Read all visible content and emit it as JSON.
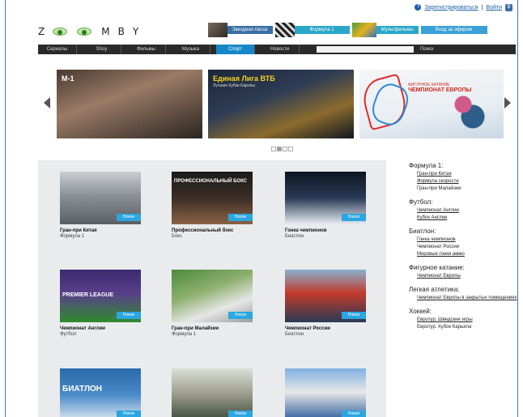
{
  "header": {
    "register_link": "Зарегистрироваться",
    "separator": "|",
    "login_link": "Войти",
    "logo_letters": [
      "Z",
      "M",
      "B",
      "Y"
    ],
    "promos": [
      "Звездная пасха",
      "Формула 1",
      "Мультфильмы",
      "Вход за эфиром"
    ]
  },
  "nav": {
    "items": [
      "Сериалы",
      "Shoy",
      "Фильмы",
      "Музыка",
      "Спорт",
      "Новости"
    ],
    "active_index": 4,
    "search_placeholder": "",
    "search_button": "Поиск"
  },
  "carousel": {
    "slides": [
      {
        "title": "M-1",
        "subtitle": ""
      },
      {
        "title": "Единая Лига ВТБ",
        "subtitle": "Лучшие Кубки Европы"
      },
      {
        "title": "ЧЕМПИОНАТ ЕВРОПЫ",
        "subtitle": "ФИГУРНОЕ КАТАНИЕ"
      }
    ],
    "pages": 4,
    "active_page": 1
  },
  "cards": [
    {
      "title": "Гран-при Китая",
      "subtitle": "Формула 1",
      "badge": "Новое",
      "image_text": ""
    },
    {
      "title": "Профессиональный бокс",
      "subtitle": "Бокс",
      "badge": "Новое",
      "image_text": "ПРОФЕССИОНАЛЬНЫЙ БОКС"
    },
    {
      "title": "Гонка чемпионов",
      "subtitle": "Биатлон",
      "badge": "Новое",
      "image_text": ""
    },
    {
      "title": "Чемпионат Англии",
      "subtitle": "Футбол",
      "badge": "Новое",
      "image_text": "PREMIER LEAGUE"
    },
    {
      "title": "Гран-при Малайзии",
      "subtitle": "Формула 1",
      "badge": "Новое",
      "image_text": ""
    },
    {
      "title": "Чемпионат России",
      "subtitle": "Биатлон",
      "badge": "Новое",
      "image_text": ""
    },
    {
      "title": "",
      "subtitle": "",
      "badge": "Новое",
      "image_text": "БИАТЛОН"
    },
    {
      "title": "",
      "subtitle": "",
      "badge": "Новое",
      "image_text": ""
    },
    {
      "title": "",
      "subtitle": "",
      "badge": "Новое",
      "image_text": ""
    }
  ],
  "sidebar": [
    {
      "title": "Формула 1:",
      "links": [
        "Гран-при Китая",
        "Формула скорости",
        "Гран-при Малайзии"
      ]
    },
    {
      "title": "Футбол:",
      "links": [
        "Чемпионат Англии",
        "Кубок Англии"
      ]
    },
    {
      "title": "Биатлон:",
      "links": [
        "Гонка чемпионов",
        "Чемпионат России",
        "Мировые гонки аммо"
      ]
    },
    {
      "title": "Фигурное катание:",
      "links": [
        "Чемпионат Европы"
      ]
    },
    {
      "title": "Легкая атлетика:",
      "links": [
        "Чемпионат Европы в закрытых помещениях"
      ]
    },
    {
      "title": "Хоккей:",
      "links": [
        "Евротур. Шведские игры",
        "Евротур. Кубок Карьяла"
      ]
    }
  ]
}
